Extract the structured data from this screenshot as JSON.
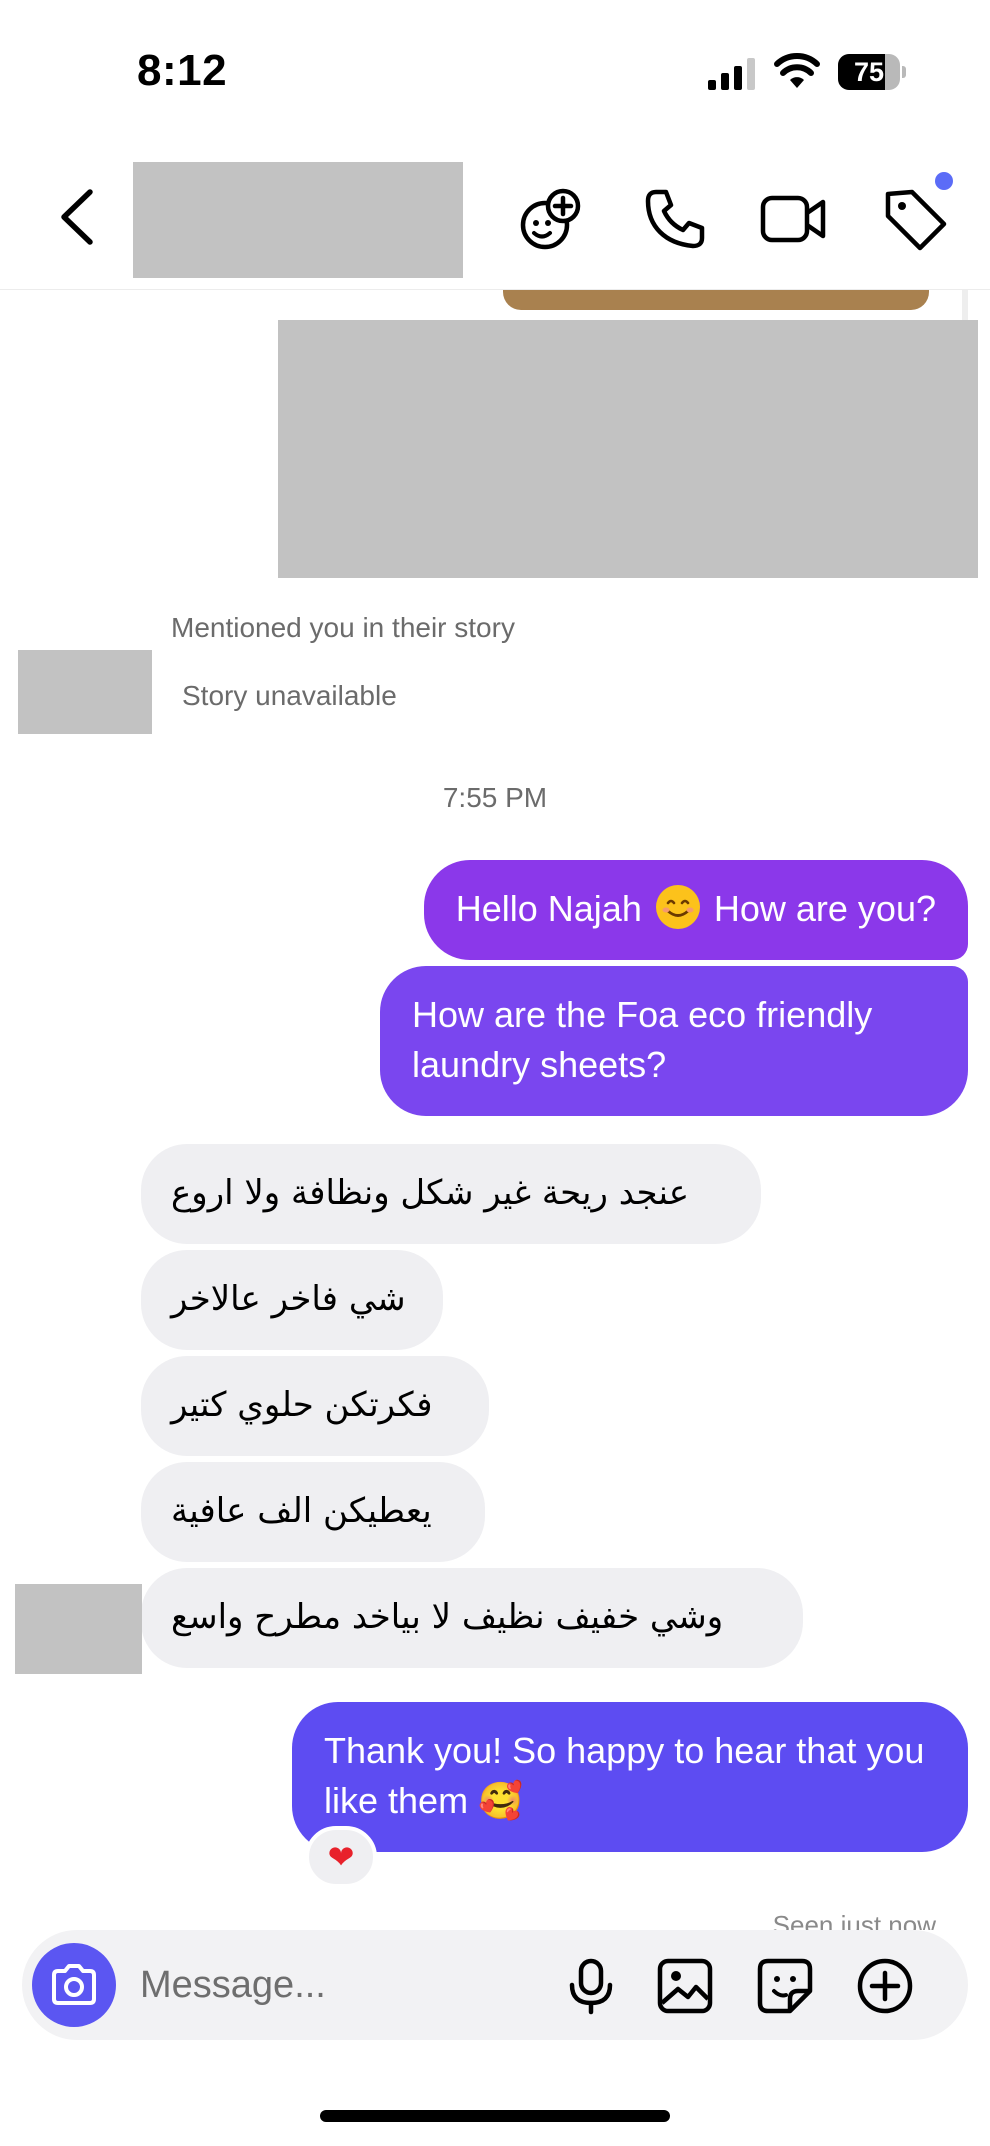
{
  "status_bar": {
    "time": "8:12",
    "battery_text": "75",
    "battery_level": 0.75
  },
  "header": {
    "back_icon": "chevron-left-icon",
    "icons": [
      "effects-icon",
      "phone-icon",
      "video-camera-icon",
      "tag-icon"
    ],
    "accent_color": "#5b6cf7"
  },
  "chat": {
    "story_mention": {
      "caption": "Mentioned you in their story",
      "status": "Story unavailable"
    },
    "timestamp": "7:55 PM",
    "outgoing_1": {
      "before": "Hello Najah",
      "after": "How are you?",
      "emoji": "smiling-face-icon"
    },
    "outgoing_2": "How are the Foa eco friendly laundry sheets?",
    "incoming": [
      "عنجد ريحة غير شكل ونظافة ولا اروع",
      "شي فاخر عالاخر",
      "فكرتكن حلوي كتير",
      "يعطيكن الف عافية",
      "وشي خفيف نظيف لا بياخد مطرح واسع"
    ],
    "outgoing_3": {
      "text": "Thank you! So happy to hear that you like them",
      "emoji": "🥰"
    },
    "reaction": "❤",
    "seen": "Seen just now"
  },
  "composer": {
    "placeholder": "Message...",
    "icons": [
      "camera-icon",
      "microphone-icon",
      "gallery-icon",
      "sticker-icon",
      "plus-icon"
    ],
    "camera_color": "#5b56f2"
  },
  "colors": {
    "bubble_purple": "#8b38ea",
    "bubble_violet": "#7a46ef",
    "bubble_indigo": "#5d4cf2",
    "bubble_incoming": "#efeff2"
  }
}
